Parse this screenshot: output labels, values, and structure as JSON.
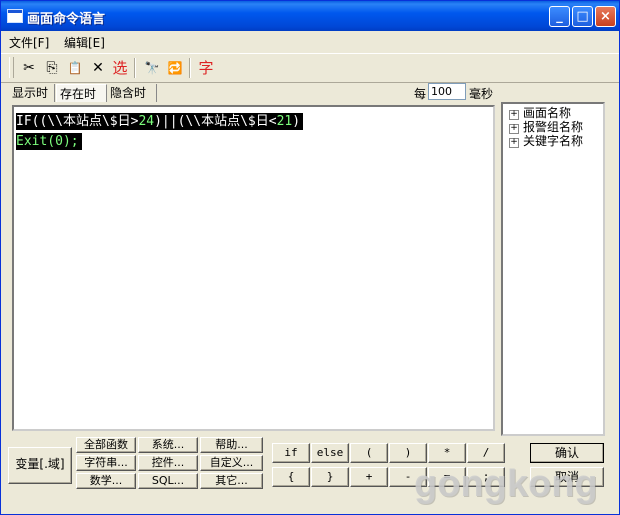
{
  "window": {
    "title": "画面命令语言",
    "controls": [
      "_",
      "□",
      "×"
    ]
  },
  "menu": {
    "items": [
      "文件[F]",
      "编辑[E]"
    ]
  },
  "toolbar": {
    "tools": [
      {
        "name": "cut-icon",
        "glyph": "✂"
      },
      {
        "name": "copy-icon",
        "glyph": "⎘"
      },
      {
        "name": "paste-icon",
        "glyph": "📋"
      },
      {
        "name": "delete-icon",
        "glyph": "✕"
      },
      {
        "name": "select-icon",
        "glyph": "选"
      },
      {
        "name": "find-icon",
        "glyph": "🔭"
      },
      {
        "name": "replace-icon",
        "glyph": "🔁"
      },
      {
        "name": "font-icon",
        "glyph": "字"
      }
    ]
  },
  "tabs": [
    "显示时",
    "存在时",
    "隐含时"
  ],
  "active_tab": "存在时",
  "interval": {
    "label": "每",
    "value": "100",
    "unit": "毫秒"
  },
  "code": {
    "line1": {
      "a": "IF((\\\\本站点\\$日>",
      "b": "24",
      "c": ")||(\\\\本站点\\$日<",
      "d": "21",
      "e": ")"
    },
    "line2": {
      "a": "Exit(",
      "b": "0",
      "c": ");"
    }
  },
  "tree": [
    "画面名称",
    "报警组名称",
    "关键字名称"
  ],
  "buttons": {
    "variable": "变量[.域]",
    "functions": [
      "全部函数",
      "字符串...",
      "数学...",
      "系统...",
      "控件...",
      "SQL...",
      "帮助...",
      "自定义...",
      "其它..."
    ],
    "operators_row1": [
      "if",
      "else",
      "(",
      ")",
      "*",
      "/"
    ],
    "operators_row2": [
      "{",
      "}",
      "+",
      "-",
      "=",
      ";"
    ],
    "ok": "确认",
    "cancel": "取消"
  },
  "watermark": "gongkong"
}
